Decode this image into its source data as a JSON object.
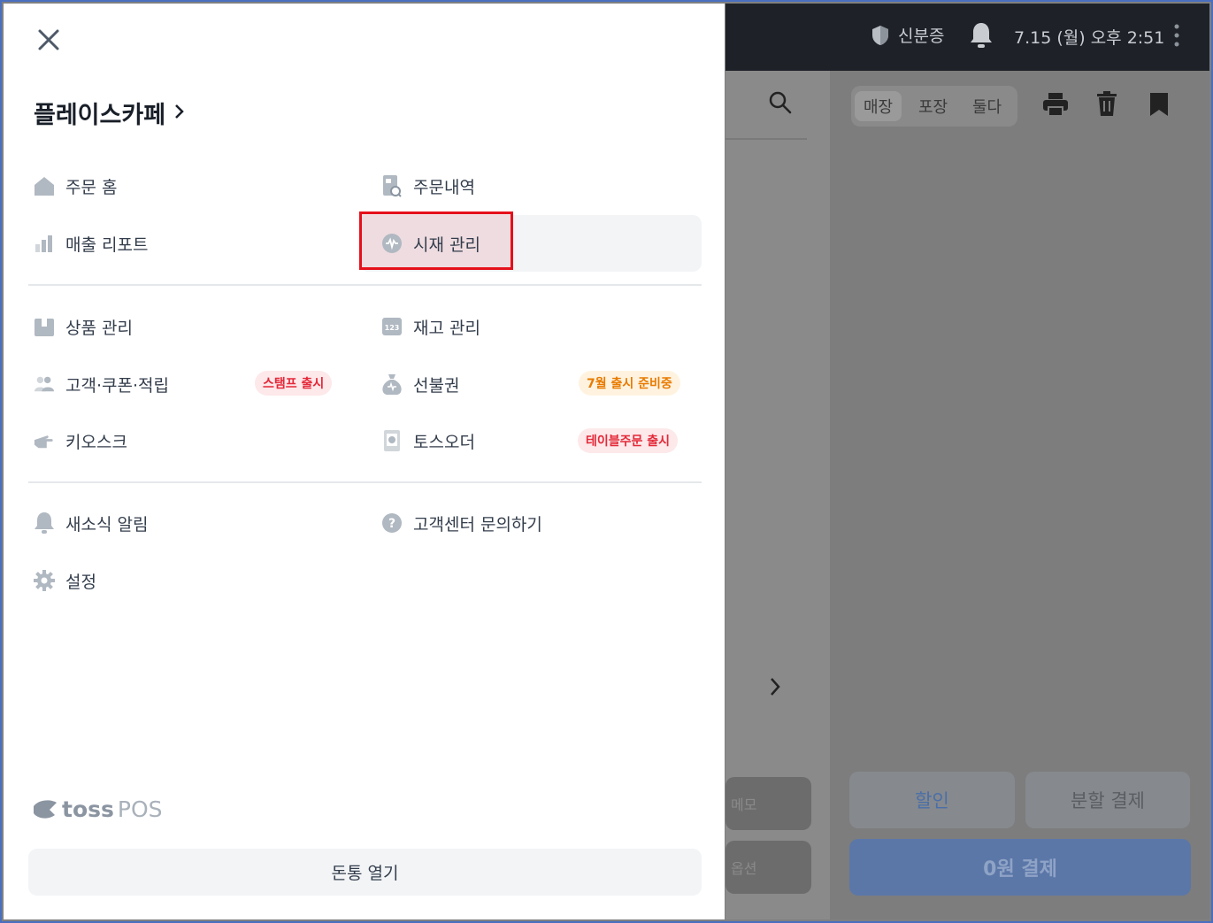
{
  "topbar": {
    "id_label": "신분증",
    "datetime": "7.15 (월) 오후 2:51"
  },
  "order": {
    "tabs": [
      "매장",
      "포장",
      "둘다"
    ],
    "memo": "메모",
    "option": "옵션",
    "discount": "할인",
    "split_pay": "분할 결제",
    "pay": "0원 결제"
  },
  "drawer": {
    "store_name": "플레이스카페",
    "menu": {
      "order_home": "주문 홈",
      "order_history": "주문내역",
      "sales_report": "매출 리포트",
      "cash_management": "시재 관리",
      "product_management": "상품 관리",
      "inventory_management": "재고 관리",
      "customers": "고객·쿠폰·적립",
      "customers_badge": "스탬프 출시",
      "gift_card": "선불권",
      "gift_card_badge": "7월 출시 준비중",
      "kiosk": "키오스크",
      "toss_order": "토스오더",
      "toss_order_badge": "테이블주문 출시",
      "notifications": "새소식 알림",
      "support": "고객센터 문의하기",
      "settings": "설정"
    },
    "logo": {
      "brand": "toss",
      "product": "POS"
    },
    "open_drawer": "돈통 열기"
  },
  "colors": {
    "badge_red_bg": "#fde8ea",
    "badge_red_text": "#e42939",
    "badge_orange_bg": "#fff3e0",
    "badge_orange_text": "#e87b00",
    "highlight": "#e5101b",
    "pay_button": "#5b77a8"
  },
  "icons": [
    "close-icon",
    "home-icon",
    "receipt-search-icon",
    "bar-chart-icon",
    "cash-wave-icon",
    "box-icon",
    "number-icon",
    "people-icon",
    "money-bag-icon",
    "pointer-hand-icon",
    "tablet-icon",
    "bell-icon",
    "question-icon",
    "gear-icon",
    "shield-icon",
    "search-icon",
    "printer-icon",
    "trash-icon",
    "bookmark-icon",
    "more-vertical-icon",
    "chevron-right-icon"
  ]
}
